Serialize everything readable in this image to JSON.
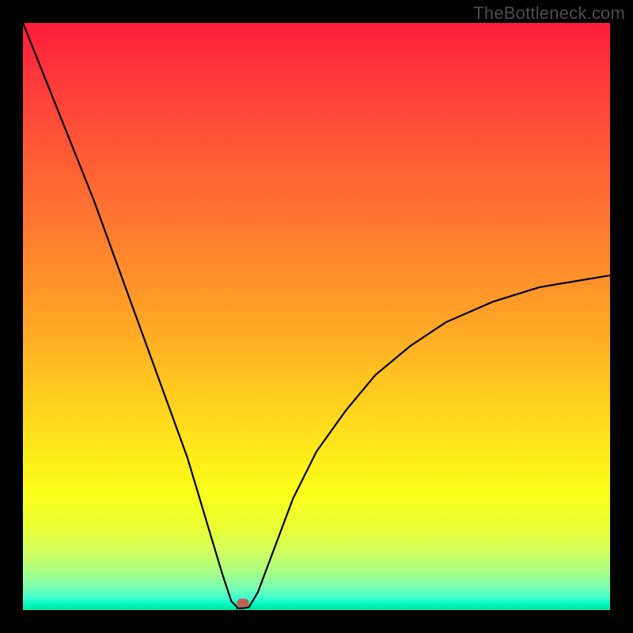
{
  "watermark": "TheBottleneck.com",
  "chart_data": {
    "type": "line",
    "title": "",
    "xlabel": "",
    "ylabel": "",
    "xlim": [
      0,
      100
    ],
    "ylim": [
      0,
      100
    ],
    "curve": {
      "description": "V-shaped bottleneck curve reaching ~0 at x≈37",
      "vertex_x": 37,
      "vertex_y": 0,
      "left_start": {
        "x": 0,
        "y": 100
      },
      "right_end": {
        "x": 100,
        "y": 57
      },
      "left_branch": [
        {
          "x": 0,
          "y": 100
        },
        {
          "x": 4,
          "y": 90
        },
        {
          "x": 8,
          "y": 80
        },
        {
          "x": 12,
          "y": 70
        },
        {
          "x": 16,
          "y": 59
        },
        {
          "x": 20,
          "y": 48
        },
        {
          "x": 24,
          "y": 37
        },
        {
          "x": 28,
          "y": 26
        },
        {
          "x": 31,
          "y": 16
        },
        {
          "x": 34,
          "y": 6
        },
        {
          "x": 35.5,
          "y": 1.5
        },
        {
          "x": 36.5,
          "y": 0.5
        }
      ],
      "right_branch": [
        {
          "x": 38.5,
          "y": 0.5
        },
        {
          "x": 40,
          "y": 3
        },
        {
          "x": 43,
          "y": 11
        },
        {
          "x": 46,
          "y": 19
        },
        {
          "x": 50,
          "y": 27
        },
        {
          "x": 55,
          "y": 34
        },
        {
          "x": 60,
          "y": 40
        },
        {
          "x": 66,
          "y": 45
        },
        {
          "x": 72,
          "y": 49
        },
        {
          "x": 80,
          "y": 52.5
        },
        {
          "x": 88,
          "y": 55
        },
        {
          "x": 100,
          "y": 57
        }
      ]
    },
    "marker": {
      "x": 37.5,
      "y": 1.2,
      "color": "#c06058"
    },
    "gradient_stops": [
      {
        "pos": 0,
        "color": "#ff1b3c"
      },
      {
        "pos": 50,
        "color": "#ffa227"
      },
      {
        "pos": 80,
        "color": "#fbff1a"
      },
      {
        "pos": 100,
        "color": "#00e59a"
      }
    ]
  }
}
